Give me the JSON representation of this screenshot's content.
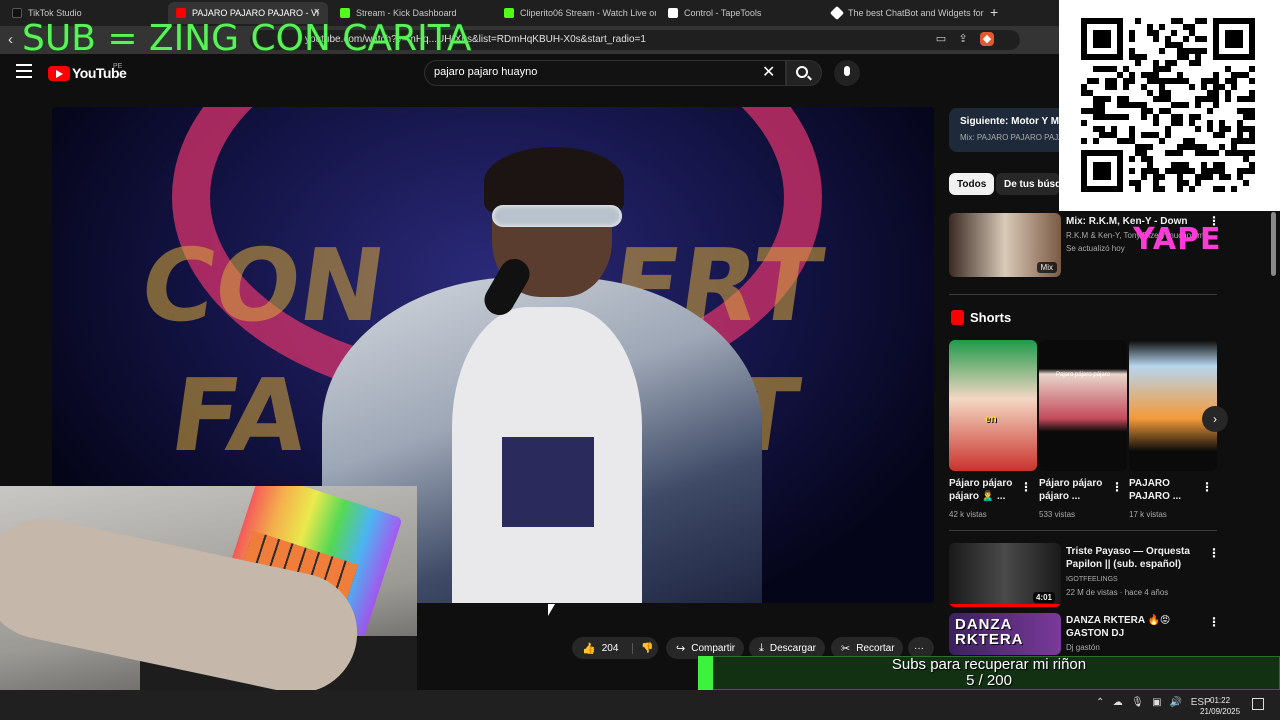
{
  "browser": {
    "tabs": [
      {
        "label": "TikTok Studio",
        "favicon_color": "#111111"
      },
      {
        "label": "PAJARO PAJARO PAJARO - Vi",
        "favicon_color": "#ff0000"
      },
      {
        "label": "Stream - Kick Dashboard",
        "favicon_color": "#53fc18"
      },
      {
        "label": "Cliperito06 Stream - Watch Live on K",
        "favicon_color": "#53fc18"
      },
      {
        "label": "Control - TapeTools",
        "favicon_color": "#ffffff"
      },
      {
        "label": "The best ChatBot and Widgets for Ki",
        "favicon_color": "#ffffff"
      }
    ],
    "url": "youtube.com/watch?v=mHq...UH-X0s&list=RDmHqKBUH-X0s&start_radio=1"
  },
  "overlay": {
    "sub_text": "SUB = ZING CON CARITA",
    "yape_text": "YAPE",
    "goal": {
      "label": "Subs para recuperar mi riñon",
      "current": 5,
      "target": 200,
      "count_text": "5 / 200"
    }
  },
  "youtube": {
    "logo_text": "YouTube",
    "country": "PE",
    "search_value": "pajaro pajaro huayno",
    "actions": {
      "likes": "204",
      "share": "Compartir",
      "download": "Descargar",
      "clip": "Recortar",
      "more": "···"
    },
    "next": {
      "label": "Siguiente: Motor Y Moti",
      "sub": "Mix: PAJARO PAJARO PAJA"
    },
    "chips": [
      "Todos",
      "De tus búsque"
    ],
    "mix": {
      "title": "Mix: R.K.M, Ken-Y - Down",
      "channel": "R.K.M & Ken-Y, Tony Dize y muchos más",
      "updated": "Se actualizó hoy",
      "badge": "Mix"
    },
    "shorts_heading": "Shorts",
    "shorts": [
      {
        "title": "Pájaro pájaro pájaro 🙎‍♂️ ...",
        "views": "42 k vistas",
        "thumb_text": "en"
      },
      {
        "title": "Pájaro pájaro pájaro ...",
        "views": "533 vistas",
        "thumb_text": "Pajaro pájaro pájaro"
      },
      {
        "title": "PAJARO PAJARO ...",
        "views": "17 k vistas",
        "thumb_text": ""
      }
    ],
    "videos": [
      {
        "title": "Triste Payaso — Orquesta Papilon || (sub. español)",
        "channel": "IGOTFEELINGS",
        "meta": "22 M de vistas · hace 4 años",
        "duration": "4:01"
      },
      {
        "title": "DANZA RKTERA 🔥😡 GASTON DJ",
        "channel": "Dj gastón",
        "meta": "",
        "thumb_text": "DANZA RKTERA"
      }
    ]
  },
  "taskbar": {
    "lang": "ESP",
    "time": "01:22",
    "date": "21/09/2025"
  },
  "colors": {
    "accent_green": "#3cf23c",
    "youtube_red": "#ff0000",
    "yape_pink": "#ff3bd7",
    "sub_green": "#5af15a"
  }
}
